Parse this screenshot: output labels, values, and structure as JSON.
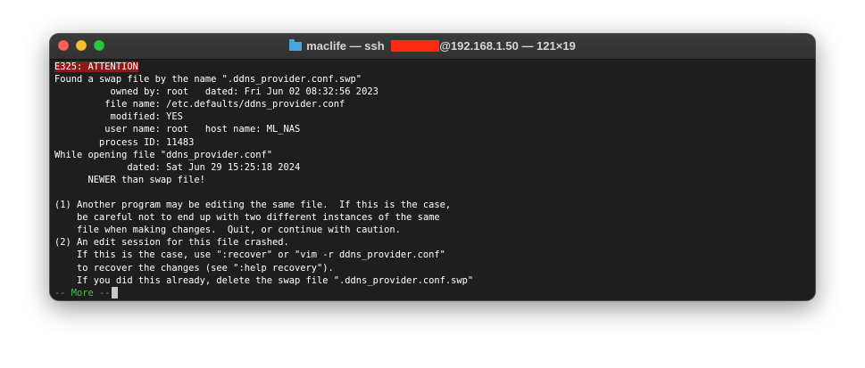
{
  "window": {
    "title_prefix": "maclife — ssh ",
    "title_suffix": "@192.168.1.50 — 121×19"
  },
  "terminal": {
    "attention": "E325: ATTENTION",
    "lines": [
      "Found a swap file by the name \".ddns_provider.conf.swp\"",
      "          owned by: root   dated: Fri Jun 02 08:32:56 2023",
      "         file name: /etc.defaults/ddns_provider.conf",
      "          modified: YES",
      "         user name: root   host name: ML_NAS",
      "        process ID: 11483",
      "While opening file \"ddns_provider.conf\"",
      "             dated: Sat Jun 29 15:25:18 2024",
      "      NEWER than swap file!",
      "",
      "(1) Another program may be editing the same file.  If this is the case,",
      "    be careful not to end up with two different instances of the same",
      "    file when making changes.  Quit, or continue with caution.",
      "(2) An edit session for this file crashed.",
      "    If this is the case, use \":recover\" or \"vim -r ddns_provider.conf\"",
      "    to recover the changes (see \":help recovery\").",
      "    If you did this already, delete the swap file \".ddns_provider.conf.swp\""
    ],
    "more_prompt": "-- More --"
  }
}
